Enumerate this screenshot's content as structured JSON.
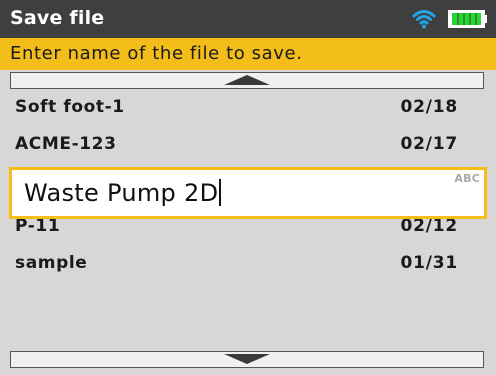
{
  "header": {
    "title": "Save file",
    "wifi_icon": "wifi-icon",
    "battery_icon": "battery-icon",
    "accent": "#f3bd1a",
    "battery_color": "#25d82f"
  },
  "prompt": {
    "text": "Enter name of the file to save."
  },
  "file_list": {
    "items": [
      {
        "name": "Soft foot-1",
        "date": "02/18"
      },
      {
        "name": "ACME-123",
        "date": "02/17"
      },
      {
        "name": "P-11",
        "date": "02/12"
      },
      {
        "name": "sample",
        "date": "01/31"
      }
    ]
  },
  "filename_input": {
    "value": "Waste Pump 2D",
    "mode": "ABC"
  },
  "scroll": {
    "up_icon": "scroll-up-icon",
    "down_icon": "scroll-down-icon"
  }
}
